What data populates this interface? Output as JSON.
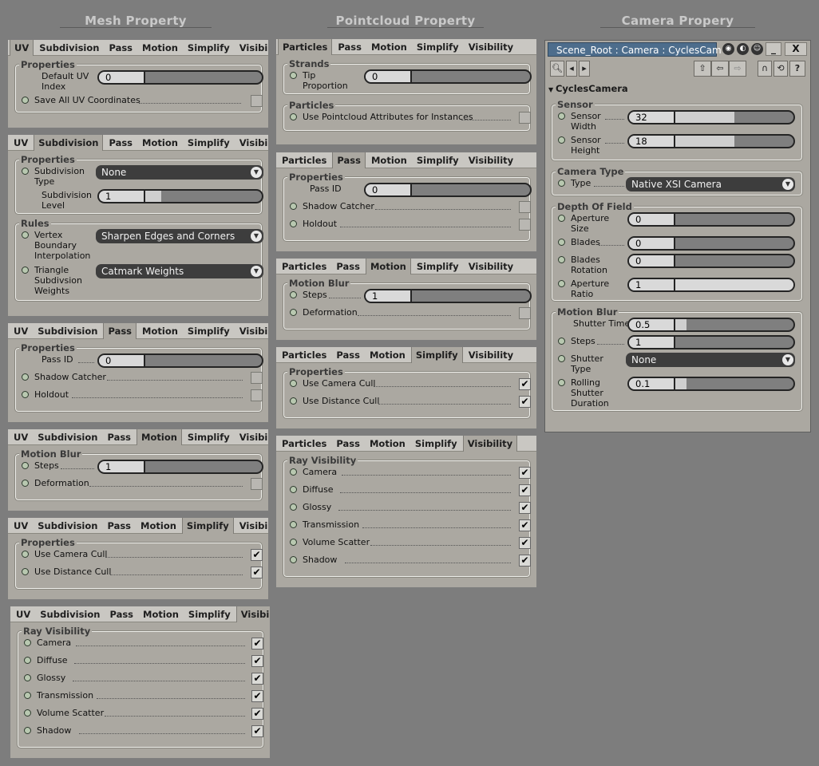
{
  "headers": {
    "mesh": "Mesh Property",
    "pointcloud": "Pointcloud Property",
    "camera": "Camera Propery"
  },
  "mesh_tabs": [
    "UV",
    "Subdivision",
    "Pass",
    "Motion",
    "Simplify",
    "Visibility"
  ],
  "pc_tabs": [
    "Particles",
    "Pass",
    "Motion",
    "Simplify",
    "Visibility"
  ],
  "mesh_uv": {
    "group": "Properties",
    "index_label": "Default UV Index",
    "index_val": "0",
    "save_label": "Save All UV Coordinates"
  },
  "mesh_subdiv": {
    "group": "Properties",
    "type_label": "Subdivision Type",
    "type_val": "None",
    "level_label": "Subdivision Level",
    "level_val": "1",
    "rules_group": "Rules",
    "vbi_label": "Vertex Boundary Interpolation",
    "vbi_val": "Sharpen Edges and Corners",
    "tsw_label": "Triangle Subdivsion Weights",
    "tsw_val": "Catmark Weights"
  },
  "mesh_pass": {
    "group": "Properties",
    "pass_label": "Pass ID",
    "pass_val": "0",
    "shadow_label": "Shadow Catcher",
    "holdout_label": "Holdout"
  },
  "mesh_motion": {
    "group": "Motion Blur",
    "steps_label": "Steps",
    "steps_val": "1",
    "deform_label": "Deformation"
  },
  "mesh_simplify": {
    "group": "Properties",
    "cam_label": "Use Camera Cull",
    "dist_label": "Use Distance Cull"
  },
  "vis": {
    "group": "Ray Visibility",
    "items": [
      "Camera",
      "Diffuse",
      "Glossy",
      "Transmission",
      "Volume Scatter",
      "Shadow"
    ]
  },
  "pc_particles": {
    "strands_group": "Strands",
    "tip_label": "Tip Proportion",
    "tip_val": "0",
    "particles_group": "Particles",
    "use_attr_label": "Use Pointcloud Attributes for Instances"
  },
  "camera": {
    "title": "Scene_Root : Camera : CyclesCam",
    "section": "CyclesCamera",
    "sensor_group": "Sensor",
    "sensor_width_label": "Sensor Width",
    "sensor_width": "32",
    "sensor_height_label": "Sensor Height",
    "sensor_height": "18",
    "type_group": "Camera Type",
    "type_label": "Type",
    "type_val": "Native XSI Camera",
    "dof_group": "Depth Of Field",
    "ap_size_label": "Aperture Size",
    "ap_size": "0",
    "blades_label": "Blades",
    "blades": "0",
    "blades_rot_label": "Blades Rotation",
    "blades_rot": "0",
    "ap_ratio_label": "Aperture Ratio",
    "ap_ratio": "1",
    "mb_group": "Motion Blur",
    "shutter_time_label": "Shutter Time",
    "shutter_time": "0.5",
    "steps_label": "Steps",
    "steps": "1",
    "shutter_type_label": "Shutter Type",
    "shutter_type": "None",
    "rolling_label": "Rolling Shutter Duration",
    "rolling": "0.1"
  }
}
